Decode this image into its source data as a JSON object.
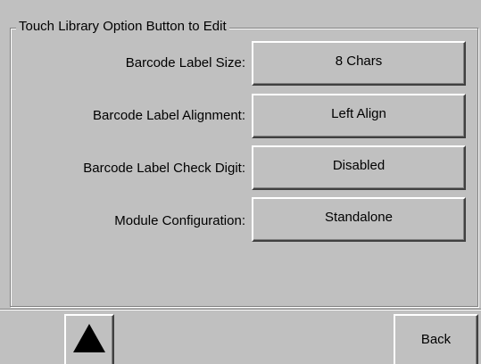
{
  "group": {
    "title": "Touch Library Option Button to Edit"
  },
  "options": [
    {
      "label": "Barcode Label Size:",
      "value": "8 Chars"
    },
    {
      "label": "Barcode Label Alignment:",
      "value": "Left Align"
    },
    {
      "label": "Barcode Label Check Digit:",
      "value": "Disabled"
    },
    {
      "label": "Module Configuration:",
      "value": "Standalone"
    }
  ],
  "footer": {
    "up_icon": "up-triangle-icon",
    "back_label": "Back"
  },
  "colors": {
    "face": "#c0c0c0",
    "highlight": "#ffffff",
    "shadow": "#808080",
    "dark_shadow": "#404040"
  }
}
